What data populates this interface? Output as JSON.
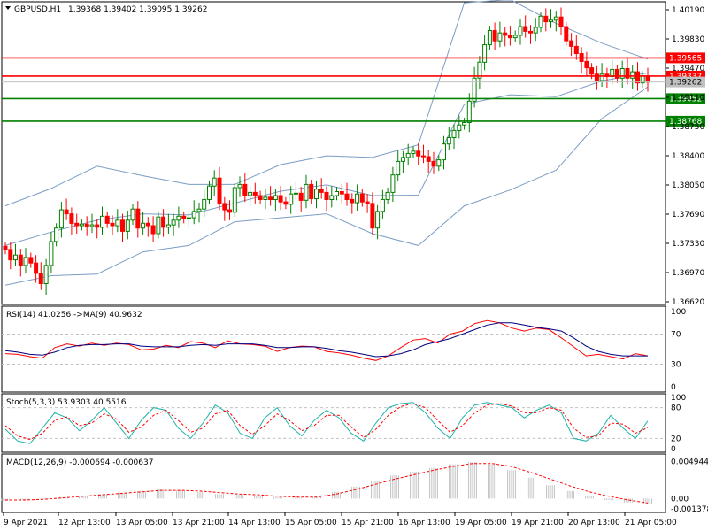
{
  "chart_data": {
    "type": "candlestick",
    "symbol_label": "GBPUSD,H1",
    "ohlc_label": "1.39368 1.39402 1.39095 1.39262",
    "main_ylim": [
      1.3648,
      1.4025
    ],
    "main_y_ticks": [
      "1.40190",
      "1.39830",
      "1.39470",
      "1.39110",
      "1.38750",
      "1.38400",
      "1.38050",
      "1.37690",
      "1.37330",
      "1.36970",
      "1.36620"
    ],
    "price_tags": [
      {
        "label": "1.39565",
        "value": 1.39565,
        "color": "#ff0000"
      },
      {
        "label": "1.39337",
        "value": 1.39337,
        "color": "#ff0000"
      },
      {
        "label": "1.39262",
        "value": 1.39262,
        "color": "#c0c0c0"
      },
      {
        "label": "1.39052",
        "value": 1.39052,
        "color": "#008000"
      },
      {
        "label": "1.38768",
        "value": 1.38768,
        "color": "#008000"
      }
    ],
    "x_labels": [
      "9 Apr 2021",
      "12 Apr 13:00",
      "13 Apr 05:00",
      "13 Apr 21:00",
      "14 Apr 13:00",
      "15 Apr 05:00",
      "15 Apr 21:00",
      "16 Apr 13:00",
      "19 Apr 05:00",
      "19 Apr 21:00",
      "20 Apr 13:00",
      "21 Apr 05:00"
    ],
    "close": [
      1.3715,
      1.3702,
      1.3708,
      1.3695,
      1.3705,
      1.3698,
      1.3685,
      1.3672,
      1.3695,
      1.3725,
      1.3742,
      1.3765,
      1.376,
      1.3748,
      1.3745,
      1.3747,
      1.3744,
      1.3746,
      1.3743,
      1.3757,
      1.3748,
      1.3745,
      1.3752,
      1.3738,
      1.3752,
      1.3766,
      1.3742,
      1.3748,
      1.3745,
      1.3735,
      1.3756,
      1.3743,
      1.3746,
      1.3752,
      1.3757,
      1.3754,
      1.3755,
      1.3763,
      1.3766,
      1.3778,
      1.3795,
      1.3805,
      1.3773,
      1.3765,
      1.3762,
      1.3793,
      1.3797,
      1.3783,
      1.3787,
      1.3783,
      1.3778,
      1.3781,
      1.3778,
      1.3783,
      1.3775,
      1.3772,
      1.3785,
      1.3786,
      1.3777,
      1.3797,
      1.3779,
      1.3791,
      1.3787,
      1.3778,
      1.3783,
      1.3788,
      1.3785,
      1.3778,
      1.3774,
      1.3785,
      1.3775,
      1.3773,
      1.3742,
      1.3763,
      1.3778,
      1.3787,
      1.3809,
      1.3826,
      1.3831,
      1.3836,
      1.3839,
      1.3833,
      1.3832,
      1.3826,
      1.382,
      1.3828,
      1.3848,
      1.3856,
      1.3865,
      1.3872,
      1.3875,
      1.3902,
      1.3931,
      1.3951,
      1.3973,
      1.3991,
      1.3978,
      1.3988,
      1.3985,
      1.3982,
      1.3985,
      1.3996,
      1.399,
      1.3988,
      1.3995,
      1.4009,
      1.4002,
      1.4004,
      1.4008,
      1.3996,
      1.3978,
      1.3971,
      1.3962,
      1.3952,
      1.3944,
      1.3936,
      1.3928,
      1.3936,
      1.3933,
      1.3942,
      1.3931,
      1.3943,
      1.3931,
      1.3939,
      1.3925,
      1.3934,
      1.3926
    ],
    "bb_upper": [
      1.377,
      1.3792,
      1.382,
      1.3808,
      1.3797,
      1.3797,
      1.3822,
      1.3833,
      1.3831,
      1.3847,
      1.4026,
      1.403,
      1.4,
      1.3975,
      1.3955
    ],
    "bb_lower": [
      1.367,
      1.3682,
      1.3684,
      1.3712,
      1.372,
      1.375,
      1.3755,
      1.376,
      1.3735,
      1.372,
      1.377,
      1.379,
      1.3815,
      1.388,
      1.392
    ],
    "rsi_label": "RSI(14) 41.0256  ->MA(9) 40.9632",
    "rsi_levels": [
      "100",
      "70",
      "30",
      "0"
    ],
    "rsi": [
      44,
      43,
      40,
      38,
      52,
      57,
      54,
      58,
      55,
      58,
      56,
      49,
      50,
      55,
      52,
      60,
      58,
      52,
      61,
      57,
      56,
      54,
      47,
      52,
      54,
      53,
      47,
      45,
      42,
      38,
      35,
      41,
      52,
      62,
      64,
      58,
      70,
      74,
      84,
      88,
      85,
      78,
      74,
      78,
      76,
      65,
      53,
      41,
      43,
      40,
      37,
      44,
      41
    ],
    "rsi_ma": [
      48,
      46,
      43,
      42,
      46,
      52,
      55,
      56,
      56,
      57,
      57,
      54,
      53,
      53,
      53,
      55,
      56,
      55,
      57,
      57,
      57,
      55,
      52,
      52,
      53,
      53,
      51,
      48,
      46,
      43,
      40,
      41,
      44,
      49,
      56,
      60,
      64,
      70,
      76,
      82,
      85,
      85,
      82,
      79,
      77,
      74,
      65,
      54,
      47,
      43,
      41,
      41,
      41
    ],
    "stoch_label": "Stoch(5,3,3) 53.9303 40.5516",
    "stoch_levels": [
      "100",
      "80",
      "20",
      "0"
    ],
    "stoch_main": [
      38,
      15,
      10,
      40,
      70,
      60,
      35,
      55,
      80,
      50,
      20,
      55,
      80,
      75,
      40,
      20,
      50,
      85,
      70,
      30,
      20,
      60,
      80,
      45,
      25,
      55,
      75,
      60,
      30,
      15,
      50,
      80,
      88,
      90,
      70,
      40,
      20,
      60,
      85,
      90,
      85,
      80,
      60,
      75,
      85,
      70,
      20,
      15,
      30,
      65,
      40,
      20,
      54
    ],
    "stoch_signal": [
      45,
      25,
      18,
      30,
      55,
      62,
      45,
      50,
      68,
      58,
      32,
      42,
      65,
      75,
      55,
      32,
      40,
      68,
      75,
      45,
      28,
      45,
      68,
      55,
      35,
      45,
      65,
      65,
      42,
      22,
      38,
      65,
      82,
      88,
      80,
      55,
      32,
      45,
      70,
      85,
      88,
      83,
      70,
      70,
      80,
      75,
      40,
      22,
      25,
      50,
      48,
      30,
      41
    ],
    "macd_label": "MACD(12,26,9) -0.000694 -0.000637",
    "macd_ticks": [
      "0.004944",
      "0.00",
      "-0.001378"
    ],
    "macd_ylim": [
      -0.0015,
      0.0055
    ],
    "macd_hist": [
      -0.0003,
      -0.0002,
      -0.0001,
      0.0002,
      0.0004,
      0.0006,
      0.0008,
      0.001,
      0.0012,
      0.0011,
      0.0009,
      0.0006,
      0.0005,
      0.0004,
      0.0002,
      0.0001,
      0.0003,
      0.0009,
      0.0016,
      0.0024,
      0.0031,
      0.0036,
      0.0041,
      0.0046,
      0.0049,
      0.0046,
      0.0038,
      0.0028,
      0.0018,
      0.001,
      0.0004,
      -0.0002,
      -0.0005,
      -0.0007
    ],
    "macd_signal": [
      -0.0002,
      -0.0002,
      -0.0001,
      0.0001,
      0.0003,
      0.0005,
      0.0007,
      0.0009,
      0.0011,
      0.0011,
      0.001,
      0.0008,
      0.0006,
      0.0005,
      0.0003,
      0.0002,
      0.0002,
      0.0006,
      0.0012,
      0.0019,
      0.0026,
      0.0032,
      0.0038,
      0.0043,
      0.0047,
      0.0047,
      0.0043,
      0.0035,
      0.0026,
      0.0017,
      0.0009,
      0.0003,
      -0.0002,
      -0.0006
    ],
    "colors": {
      "bull": "#008000",
      "bear": "#ff0000",
      "bollinger": "#7b9dc4",
      "rsi": "#ff0000",
      "rsi_ma": "#000080",
      "stoch_main": "#20b2aa",
      "stoch_signal": "#ff0000",
      "macd_hist": "#c0c0c0",
      "macd_signal": "#ff0000",
      "sep": "#000000"
    }
  }
}
